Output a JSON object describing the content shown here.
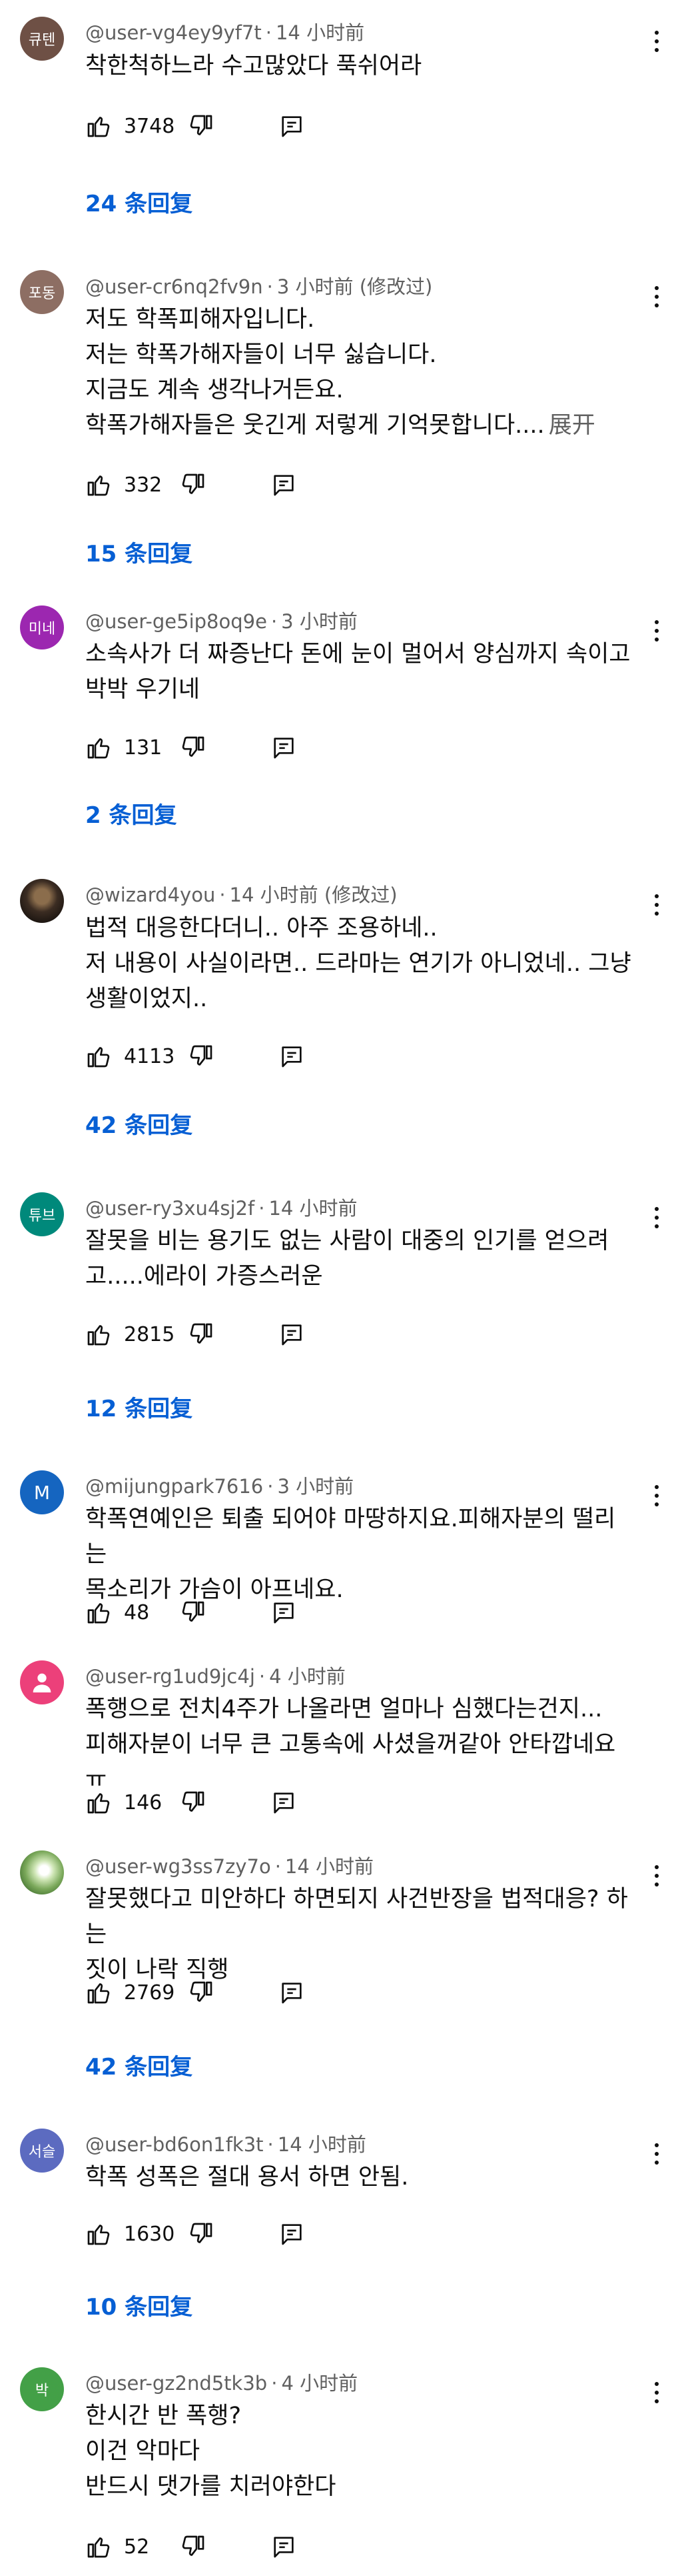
{
  "comments": [
    {
      "avatar_text": "큐텐",
      "avatar_color": "#6e5045",
      "user": "@user-vg4ey9yf7t",
      "time": "14 小时前",
      "edited": "",
      "lines": [
        "착한척하느라 수고많았다 푹쉬어라"
      ],
      "more": "",
      "likes": "3748",
      "replies": "24 条回复"
    },
    {
      "avatar_text": "포동",
      "avatar_color": "#8d6e63",
      "user": "@user-cr6nq2fv9n",
      "time": "3 小时前",
      "edited": "(修改过)",
      "lines": [
        "저도 학폭피해자입니다.",
        "저는 학폭가해자들이 너무 싫습니다.",
        "지금도 계속 생각나거든요.",
        "학폭가해자들은 웃긴게 저렇게 기억못합니다...."
      ],
      "more": "展开",
      "likes": "332",
      "replies": "15 条回复"
    },
    {
      "avatar_text": "미네",
      "avatar_color": "#9c27b0",
      "user": "@user-ge5ip8oq9e",
      "time": "3 小时前",
      "edited": "",
      "lines": [
        "소속사가 더 짜증난다 돈에 눈이 멀어서 양심까지 속이고",
        "박박 우기네"
      ],
      "more": "",
      "likes": "131",
      "replies": "2 条回复"
    },
    {
      "avatar_text": "",
      "avatar_color": "#3b2c22",
      "user": "@wizard4you",
      "time": "14 小时前",
      "edited": "(修改过)",
      "lines": [
        "법적 대응한다더니.. 아주 조용하네..",
        "저 내용이 사실이라면.. 드라마는 연기가 아니었네.. 그냥",
        "생활이었지.."
      ],
      "more": "",
      "likes": "4113",
      "replies": "42 条回复"
    },
    {
      "avatar_text": "튜브",
      "avatar_color": "#00897b",
      "user": "@user-ry3xu4sj2f",
      "time": "14 小时前",
      "edited": "",
      "lines": [
        "잘못을 비는 용기도 없는 사람이 대중의 인기를 얻으려",
        "고.....에라이 가증스러운"
      ],
      "more": "",
      "likes": "2815",
      "replies": "12 条回复"
    },
    {
      "avatar_text": "M",
      "avatar_color": "#1565c0",
      "user": "@mijungpark7616",
      "time": "3 小时前",
      "edited": "",
      "lines": [
        "학폭연예인은 퇴출 되어야 마땅하지요.피해자분의 떨리는",
        "목소리가  가슴이 아프네요."
      ],
      "more": "",
      "likes": "48",
      "replies": ""
    },
    {
      "avatar_text": "",
      "avatar_color": "#ec407a",
      "user": "@user-rg1ud9jc4j",
      "time": "4 小时前",
      "edited": "",
      "lines": [
        "폭행으로 전치4주가 나올라면 얼마나 심했다는건지...",
        "피해자분이 너무 큰 고통속에 사셨을꺼같아 안타깝네요ㅠ"
      ],
      "more": "",
      "likes": "146",
      "replies": ""
    },
    {
      "avatar_text": "",
      "avatar_color": "#7aa85a",
      "user": "@user-wg3ss7zy7o",
      "time": "14 小时前",
      "edited": "",
      "lines": [
        "잘못했다고 미안하다 하면되지 사건반장을 법적대응? 하는",
        "짓이 나락 직행"
      ],
      "more": "",
      "likes": "2769",
      "replies": "42 条回复"
    },
    {
      "avatar_text": "서슬",
      "avatar_color": "#5c6bc0",
      "user": "@user-bd6on1fk3t",
      "time": "14 小时前",
      "edited": "",
      "lines": [
        "학폭 성폭은 절대 용서 하면 안됨."
      ],
      "more": "",
      "likes": "1630",
      "replies": "10 条回复"
    },
    {
      "avatar_text": "박",
      "avatar_color": "#43a047",
      "user": "@user-gz2nd5tk3b",
      "time": "4 小时前",
      "edited": "",
      "lines": [
        "한시간 반  폭행?",
        "이건 악마다",
        "반드시 댓가를 치러야한다"
      ],
      "more": "",
      "likes": "52",
      "replies": ""
    }
  ]
}
